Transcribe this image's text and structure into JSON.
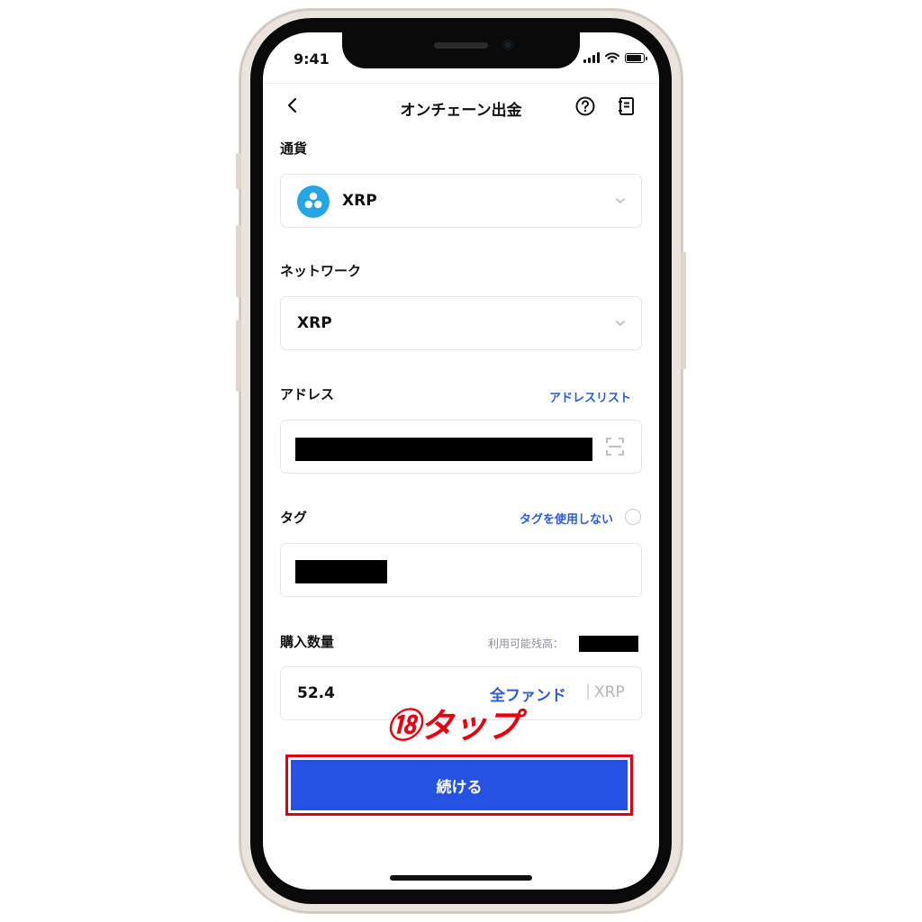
{
  "status_bar": {
    "time": "9:41"
  },
  "nav": {
    "title": "オンチェーン出金",
    "back_icon": "chevron-left-icon",
    "help_icon": "question-circle-icon",
    "history_icon": "record-icon"
  },
  "currency": {
    "label": "通貨",
    "value": "XRP",
    "logo": "xrp-logo-icon",
    "brand_color": "#25a5e4"
  },
  "network": {
    "label": "ネットワーク",
    "value": "XRP"
  },
  "address": {
    "label": "アドレス",
    "link": "アドレスリスト",
    "value": ""
  },
  "tag": {
    "label": "タグ",
    "link": "タグを使用しない",
    "value": ""
  },
  "amount": {
    "label": "購入数量",
    "balance_label": "利用可能残高：",
    "value": "52.4",
    "all_funds": "全ファンド",
    "separator": "|",
    "unit": "XRP"
  },
  "continue_button": {
    "label": "続ける",
    "color": "#2652e3"
  },
  "annotation": {
    "text": "⑱タップ",
    "color": "#e8000f",
    "highlight_color": "#e00012"
  }
}
